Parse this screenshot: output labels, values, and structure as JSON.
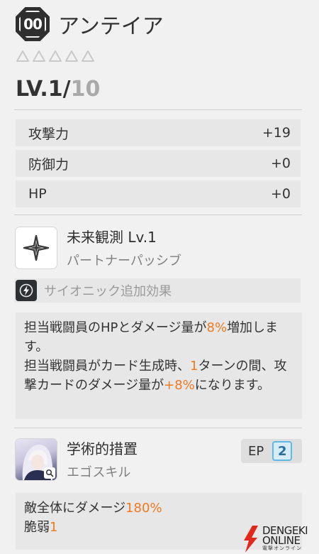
{
  "character": {
    "badge": "00",
    "name": "アンテイア",
    "stars_total": 5,
    "level_label": "LV.",
    "level_current": "1",
    "level_separator": "/",
    "level_max": "10"
  },
  "stats": [
    {
      "label": "攻撃力",
      "value": "+19"
    },
    {
      "label": "防御力",
      "value": "+0"
    },
    {
      "label": "HP",
      "value": "+0"
    }
  ],
  "passive": {
    "icon": "sparkle-icon",
    "title": "未来観測 Lv.1",
    "subtitle": "パートナーパッシブ",
    "psionic_icon": "lightning-icon",
    "psionic_label": "サイオニック追加効果",
    "desc": {
      "p1": "担当戦闘員のHPとダメージ量が",
      "h1": "8%",
      "p2": "増加します。",
      "p3": "担当戦闘員がカード生成時、",
      "h2": "1",
      "p4": "ターンの間、攻撃カードのダメージ量が",
      "h3": "+8%",
      "p5": "になります。"
    }
  },
  "ego": {
    "icon": "character-portrait",
    "title": "学術的措置",
    "subtitle": "エゴスキル",
    "ep_label": "EP",
    "ep_value": "2",
    "desc": {
      "p1": "敵全体にダメージ",
      "h1": "180%",
      "p2": "脆弱",
      "h2": "1"
    }
  },
  "watermark": {
    "line1": "DENGEKI",
    "line2": "ONLINE",
    "line3": "電撃オンライン"
  },
  "colors": {
    "highlight": "#ef7a22",
    "ep_accent": "#63b8e4",
    "background": "#f1f1f1"
  }
}
